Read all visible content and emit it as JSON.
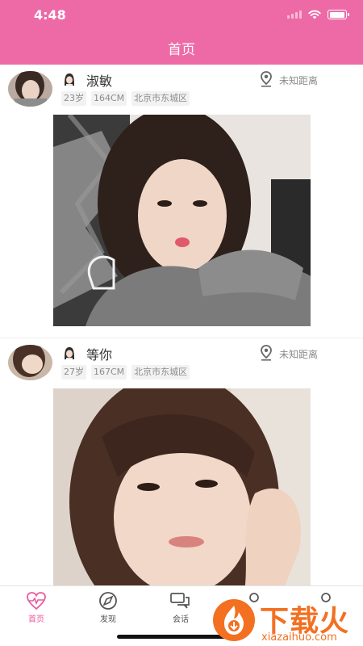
{
  "status_bar": {
    "time": "4:48"
  },
  "nav": {
    "title": "首页"
  },
  "posts": [
    {
      "name": "淑敏",
      "age": "23岁",
      "height": "164CM",
      "location": "北京市东城区",
      "distance": "未知距离"
    },
    {
      "name": "等你",
      "age": "27岁",
      "height": "167CM",
      "location": "北京市东城区",
      "distance": "未知距离"
    }
  ],
  "tabs": [
    {
      "label": "首页",
      "icon": "heart-pulse-icon",
      "active": true
    },
    {
      "label": "发现",
      "icon": "compass-icon",
      "active": false
    },
    {
      "label": "会话",
      "icon": "chat-bubbles-icon",
      "active": false
    },
    {
      "label": "",
      "icon": "contacts-icon",
      "active": false
    },
    {
      "label": "",
      "icon": "profile-icon",
      "active": false
    }
  ],
  "watermark": {
    "brand": "下载火",
    "domain": "xiazaihuo.com"
  },
  "colors": {
    "brand_pink": "#ee6aa7",
    "tab_active": "#e85aa0",
    "watermark_orange": "#f37021"
  }
}
